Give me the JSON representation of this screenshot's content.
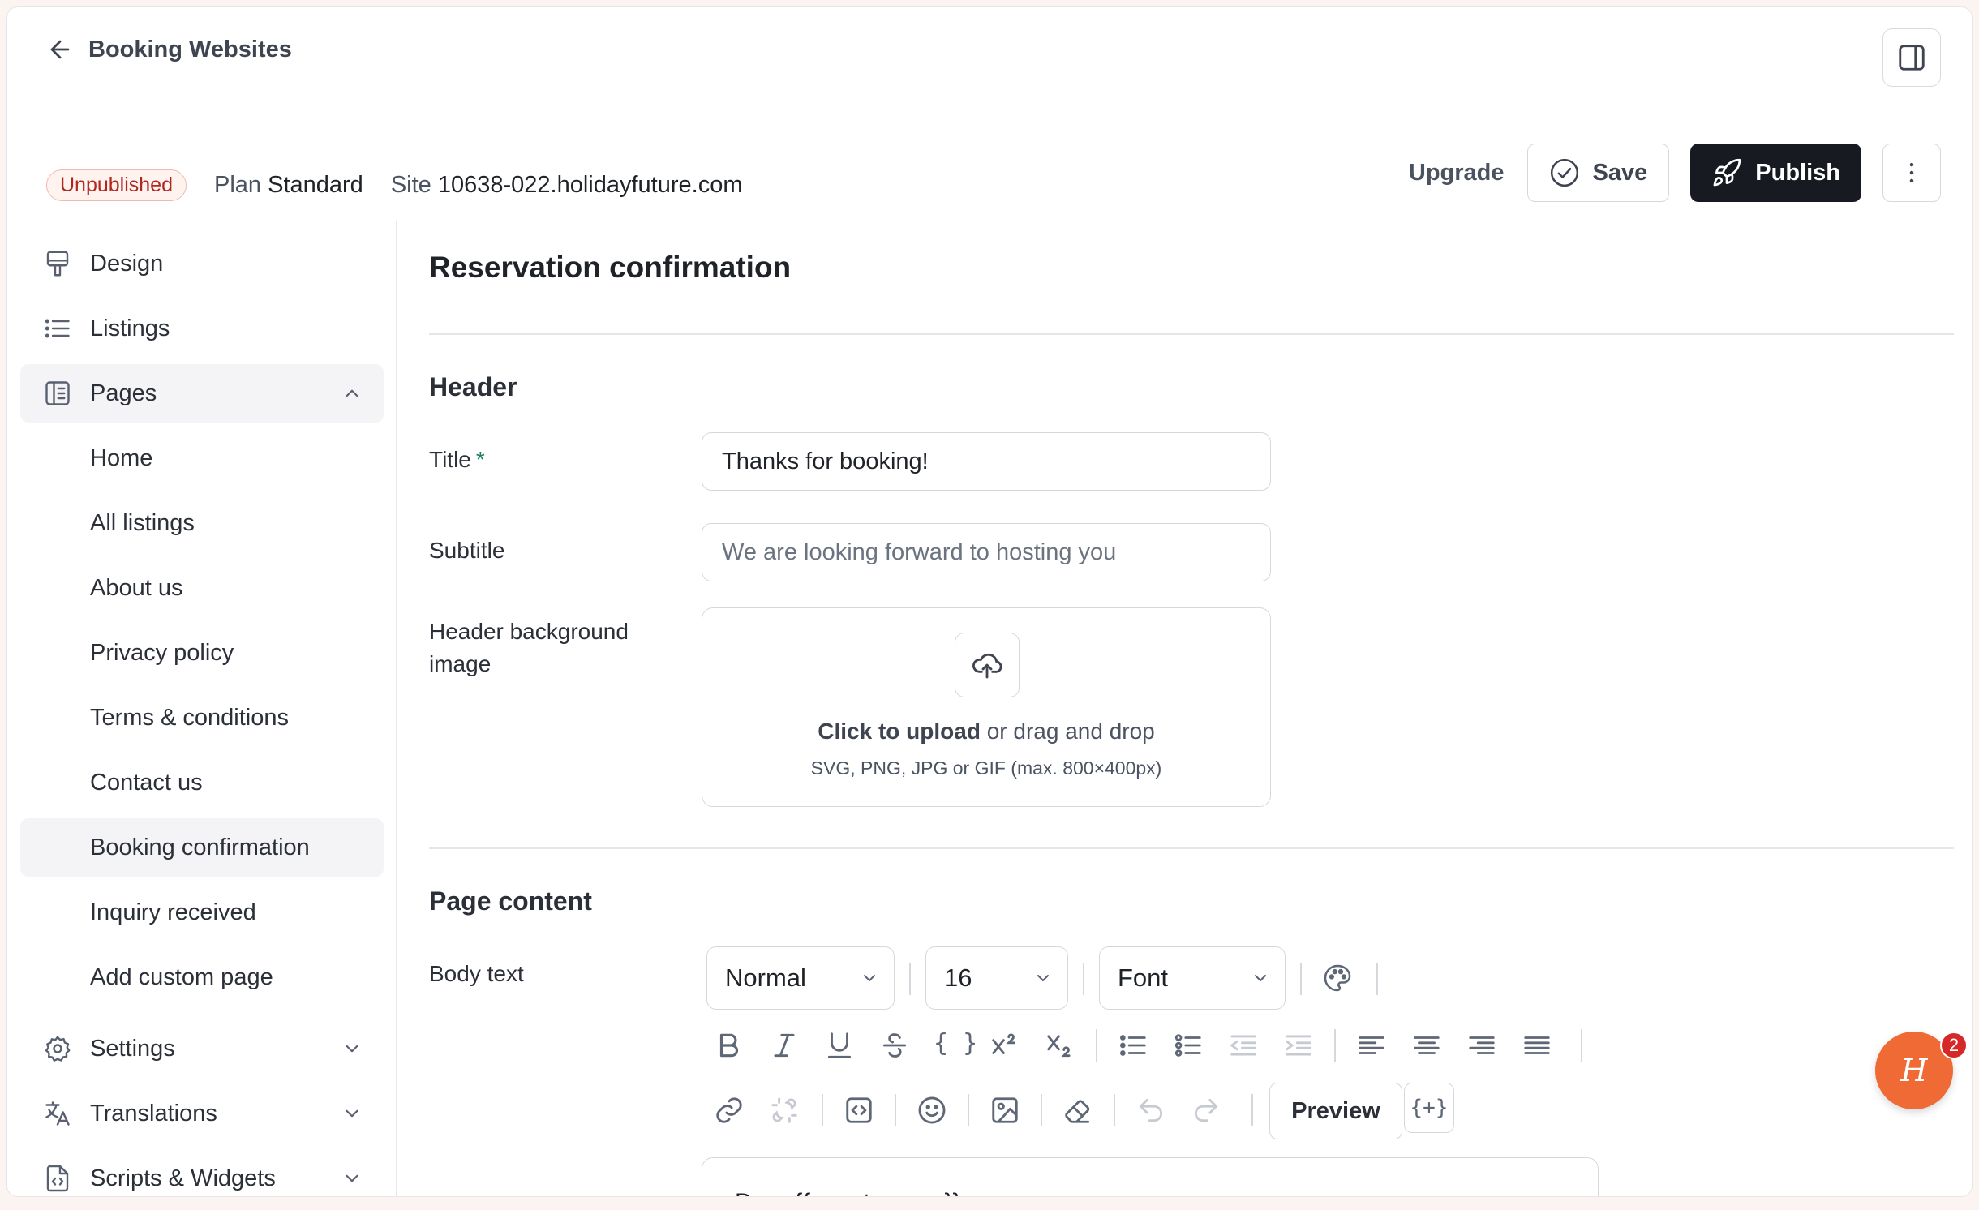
{
  "header": {
    "back_label": "Booking Websites",
    "status_badge": "Unpublished",
    "plan_label": "Plan",
    "plan_value": "Standard",
    "site_label": "Site",
    "site_value": "10638-022.holidayfuture.com",
    "upgrade_label": "Upgrade",
    "save_label": "Save",
    "publish_label": "Publish"
  },
  "sidebar": {
    "design": "Design",
    "listings": "Listings",
    "pages": "Pages",
    "sub_items": [
      "Home",
      "All listings",
      "About us",
      "Privacy policy",
      "Terms & conditions",
      "Contact us",
      "Booking confirmation",
      "Inquiry received",
      "Add custom page"
    ],
    "active_sub_item": "Booking confirmation",
    "settings": "Settings",
    "translations": "Translations",
    "scripts": "Scripts & Widgets"
  },
  "main": {
    "page_title": "Reservation confirmation",
    "header_section": "Header",
    "title_label": "Title",
    "title_required_mark": "*",
    "title_value": "Thanks for booking!",
    "subtitle_label": "Subtitle",
    "subtitle_placeholder": "We are looking forward to hosting you",
    "bg_label_line1": "Header background",
    "bg_label_line2": "image",
    "upload_bold": "Click to upload",
    "upload_rest": " or drag and drop",
    "upload_hint": "SVG, PNG, JPG or GIF (max. 800×400px)",
    "content_section": "Page content",
    "body_label": "Body text",
    "style_select": "Normal",
    "size_select": "16",
    "font_select": "Font",
    "code_braces": "{ }",
    "preview_label": "Preview",
    "vars_label": "{+}",
    "editor_text": "Dear {{guest_name}},"
  },
  "chat": {
    "logo": "H",
    "badge_count": "2"
  }
}
